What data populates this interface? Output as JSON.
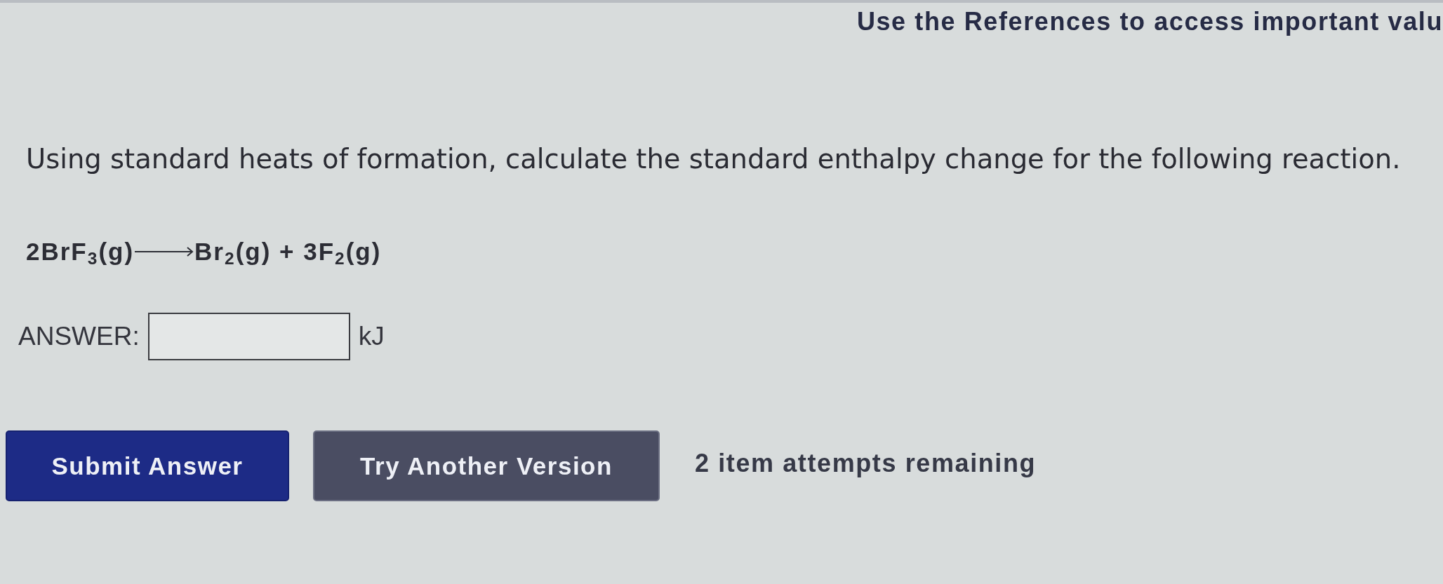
{
  "header": {
    "references_note": "Use the References to access important valu"
  },
  "question": {
    "prompt": "Using standard heats of formation, calculate the standard enthalpy change for the following reaction.",
    "equation": {
      "reactants": "2BrF$_{3}$(g)",
      "products": "Br$_{2}$(g) + 3F$_{2}$(g)"
    },
    "answer": {
      "label": "ANSWER:",
      "unit": "kJ"
    }
  },
  "buttons": [
    {
      "label": "Submit Answer",
      "kind": "primary"
    },
    {
      "label": "Try Another Version",
      "kind": "secondary"
    }
  ],
  "attempts": "2 item attempts remaining"
}
